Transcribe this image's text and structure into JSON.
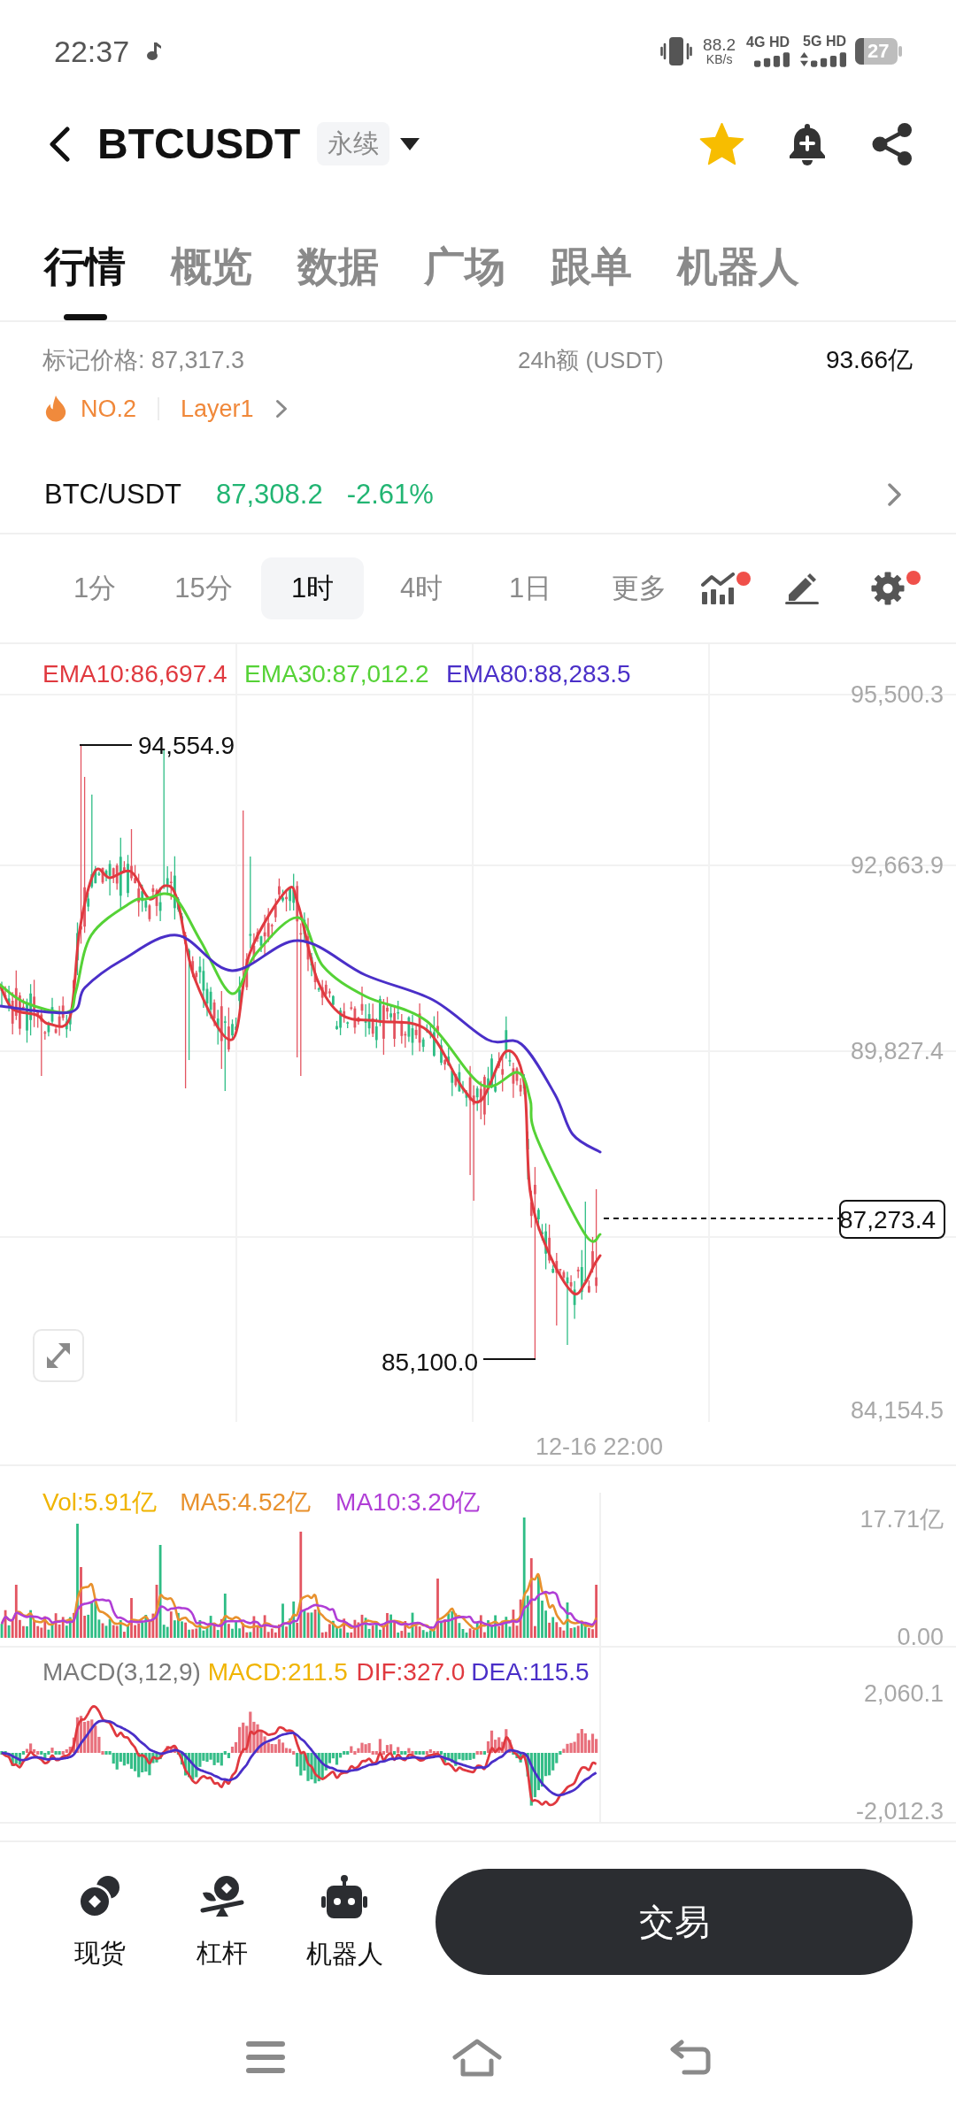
{
  "status_bar": {
    "time": "22:37",
    "speed": "88.2",
    "speed_unit": "KB/s",
    "networks": [
      {
        "label": "4G HD",
        "data_active": false
      },
      {
        "label": "5G HD",
        "data_active": true
      }
    ],
    "battery": "27"
  },
  "header": {
    "title": "BTCUSDT",
    "contract_type": "永续",
    "favorite": true
  },
  "tabs": [
    {
      "label": "行情",
      "selected": true
    },
    {
      "label": "概览",
      "selected": false
    },
    {
      "label": "数据",
      "selected": false
    },
    {
      "label": "广场",
      "selected": false
    },
    {
      "label": "跟单",
      "selected": false
    },
    {
      "label": "机器人",
      "selected": false
    }
  ],
  "market_info": {
    "mark_price": "标记价格: 87,317.3",
    "volume_label": "24h额 (USDT)",
    "volume_value": "93.66亿",
    "tags": [
      {
        "kind": "hot",
        "label": "NO.2"
      },
      {
        "kind": "sector",
        "label": "Layer1"
      }
    ]
  },
  "spot_pair": {
    "name": "BTC/USDT",
    "price": "87,308.2",
    "change": "-2.61%"
  },
  "intervals": [
    {
      "label": "1分",
      "selected": false
    },
    {
      "label": "15分",
      "selected": false
    },
    {
      "label": "1时",
      "selected": true
    },
    {
      "label": "4时",
      "selected": false
    },
    {
      "label": "1日",
      "selected": false
    },
    {
      "label": "更多",
      "selected": false
    }
  ],
  "chart_tools": [
    {
      "kind": "indicators",
      "dot": true
    },
    {
      "kind": "draw",
      "dot": false
    },
    {
      "kind": "settings",
      "dot": true
    }
  ],
  "price_chart": {
    "legend": [
      {
        "label": "EMA10:86,697.4",
        "color": "#e0393f"
      },
      {
        "label": "EMA30:87,012.2",
        "color": "#55d236"
      },
      {
        "label": "EMA80:88,283.5",
        "color": "#4a2fc8"
      }
    ],
    "price_axis": [
      "95,500.3",
      "92,663.9",
      "89,827.4",
      "84,154.5"
    ],
    "high_label": "94,554.9",
    "low_label": "85,100.0",
    "last_price": "87,273.4",
    "time_label": "12-16 22:00"
  },
  "volume_chart": {
    "legend": [
      {
        "label": "Vol:5.91亿",
        "color": "#f0b400"
      },
      {
        "label": "MA5:4.52亿",
        "color": "#e8912d"
      },
      {
        "label": "MA10:3.20亿",
        "color": "#b03ed6"
      }
    ],
    "axis": [
      "17.71亿",
      "0.00"
    ]
  },
  "macd_chart": {
    "legend": [
      {
        "label": "MACD(3,12,9)",
        "color": "#7a7a7a"
      },
      {
        "label": "MACD:211.5",
        "color": "#f0b400"
      },
      {
        "label": "DIF:327.0",
        "color": "#e0393f"
      },
      {
        "label": "DEA:115.5",
        "color": "#4a2fc8"
      }
    ],
    "axis": [
      "2,060.1",
      "-2,012.3"
    ]
  },
  "bottom_bar": {
    "shortcuts": [
      {
        "kind": "spot",
        "label": "现货"
      },
      {
        "kind": "leverage",
        "label": "杠杆"
      },
      {
        "kind": "bot",
        "label": "机器人"
      }
    ],
    "trade_button": "交易"
  }
}
